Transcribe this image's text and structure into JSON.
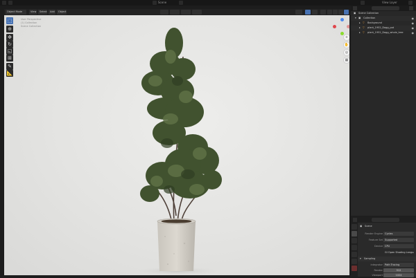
{
  "header": {
    "scene_label": "Scene",
    "view_layer_label": "View Layer",
    "options_label": "Options"
  },
  "viewport": {
    "mode_label": "Object Mode",
    "menus": [
      "View",
      "Select",
      "Add",
      "Object"
    ],
    "info_lines": [
      "User Perspective",
      "(1) Collection",
      "Scene Collection"
    ]
  },
  "outliner": {
    "items": [
      {
        "label": "Scene Collection",
        "icon": "collection-icon"
      },
      {
        "label": "Collection",
        "icon": "collection-icon"
      },
      {
        "label": "Background",
        "icon": "mesh-icon"
      },
      {
        "label": "plant_1952_Dagg_pot",
        "icon": "mesh-icon"
      },
      {
        "label": "plant_1952_Dagg_whole_tree",
        "icon": "mesh-icon"
      }
    ]
  },
  "properties": {
    "object_name": "Scene",
    "rows": [
      {
        "label": "Render Engine",
        "value": "Cycles"
      },
      {
        "label": "Feature Set",
        "value": "Supported"
      },
      {
        "label": "Device",
        "value": "CPU"
      },
      {
        "label": "",
        "value": "GI Open Shading Language"
      }
    ],
    "sampling": {
      "section_label": "Sampling",
      "integrator_label": "Integrator",
      "integrator_value": "Path Tracing",
      "render_label": "Render",
      "render_value": "512",
      "viewport_label": "Viewport",
      "viewport_value": "1024"
    }
  },
  "colors": {
    "accent": "#4772b3",
    "axis_x": "#e0474c",
    "axis_y": "#8bdc2e",
    "axis_z": "#4b8af0"
  }
}
